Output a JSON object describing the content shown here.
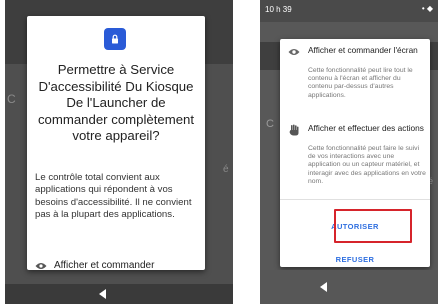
{
  "left_screen": {
    "dialog_title": "Permettre à Service D'accessibilité Du Kiosque De l'Launcher de commander complètement votre appareil?",
    "dialog_body": "Le contrôle total convient aux applications qui répondent à vos besoins d'accessibilité. Il ne convient pas à la plupart des applications.",
    "feature_label": "Afficher et commander",
    "background_letter": "C",
    "background_edge": "é"
  },
  "right_screen": {
    "status_time": "10 h 39",
    "status_icons": "• ◆",
    "background_letter": "C",
    "background_edge": "é",
    "permissions": [
      {
        "icon": "eye-icon",
        "title": "Afficher et commander l'écran",
        "description": "Cette fonctionnalité peut lire tout le contenu à l'écran et afficher du contenu par-dessus d'autres applications."
      },
      {
        "icon": "hand-icon",
        "title": "Afficher et effectuer des actions",
        "description": "Cette fonctionnalité peut faire le suivi de vos interactions avec une application ou un capteur matériel, et interagir avec des applications en votre nom."
      }
    ],
    "allow_label": "AUTORISER",
    "deny_label": "REFUSER"
  },
  "colors": {
    "accent": "#2f6fe0",
    "shield": "#2a5bd7",
    "highlight": "#d6242b"
  }
}
